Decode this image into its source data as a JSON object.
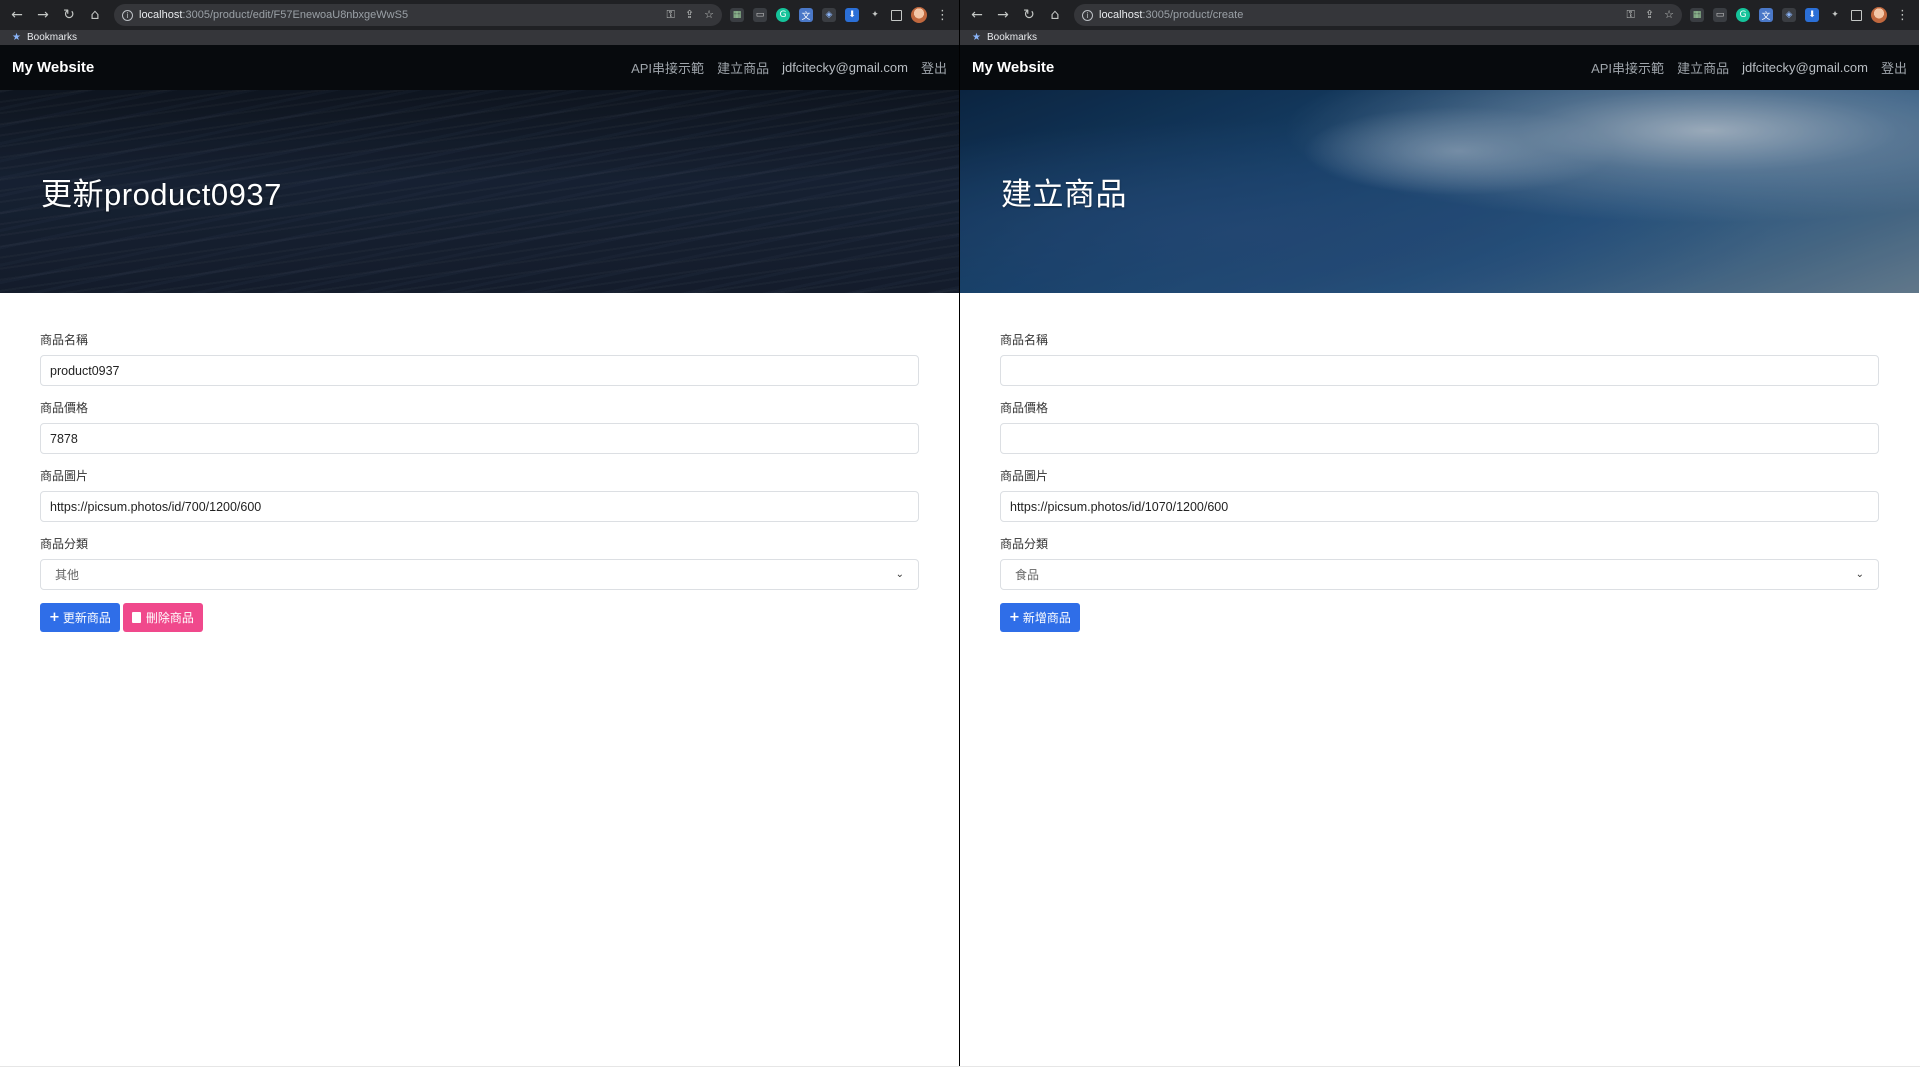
{
  "left": {
    "url_host": "localhost",
    "url_path": ":3005/product/edit/F57EnewoaU8nbxgeWwS5",
    "bookmarks_label": "Bookmarks",
    "brand": "My Website",
    "nav": [
      "API串接示範",
      "建立商品",
      "jdfcitecky@gmail.com",
      "登出"
    ],
    "hero_title": "更新product0937",
    "fields": {
      "name_label": "商品名稱",
      "name_value": "product0937",
      "price_label": "商品價格",
      "price_value": "7878",
      "image_label": "商品圖片",
      "image_value": "https://picsum.photos/id/700/1200/600",
      "category_label": "商品分類",
      "category_value": "其他"
    },
    "buttons": {
      "update": "更新商品",
      "delete": "刪除商品"
    }
  },
  "right": {
    "url_host": "localhost",
    "url_path": ":3005/product/create",
    "bookmarks_label": "Bookmarks",
    "brand": "My Website",
    "nav": [
      "API串接示範",
      "建立商品",
      "jdfcitecky@gmail.com",
      "登出"
    ],
    "hero_title": "建立商品",
    "fields": {
      "name_label": "商品名稱",
      "name_value": "",
      "price_label": "商品價格",
      "price_value": "",
      "image_label": "商品圖片",
      "image_value": "https://picsum.photos/id/1070/1200/600",
      "category_label": "商品分類",
      "category_value": "食品"
    },
    "buttons": {
      "create": "新增商品"
    }
  },
  "colors": {
    "primary": "#2f6ee8",
    "danger": "#f0498c",
    "navbar": "#070a0d",
    "chrome": "#202124"
  },
  "icons": [
    "back-arrow-icon",
    "forward-arrow-icon",
    "reload-icon",
    "home-icon",
    "info-icon",
    "key-icon",
    "share-icon",
    "bookmark-star-icon",
    "extension-icons",
    "puzzle-icon",
    "sidepanel-icon",
    "profile-avatar",
    "menu-kebab-icon",
    "plus-icon",
    "trash-icon",
    "chevron-down-icon"
  ]
}
